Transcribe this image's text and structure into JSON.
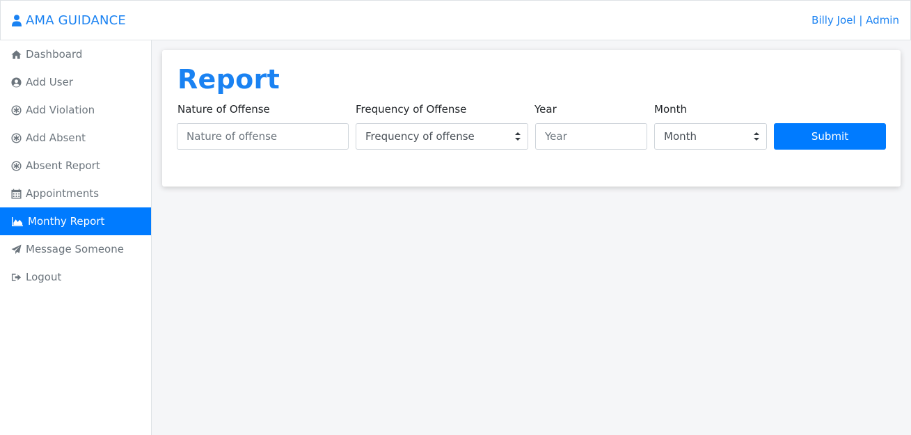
{
  "header": {
    "brand": "AMA GUIDANCE",
    "brand_icon": "user-icon",
    "user": "Billy Joel | Admin"
  },
  "sidebar": {
    "items": [
      {
        "label": "Dashboard",
        "icon": "home-icon",
        "active": false
      },
      {
        "label": "Add User",
        "icon": "user-circle-icon",
        "active": false
      },
      {
        "label": "Add Violation",
        "icon": "asterisk-circle-icon",
        "active": false
      },
      {
        "label": "Add Absent",
        "icon": "asterisk-circle-icon",
        "active": false
      },
      {
        "label": "Absent Report",
        "icon": "asterisk-circle-icon",
        "active": false
      },
      {
        "label": "Appointments",
        "icon": "calendar-icon",
        "active": false
      },
      {
        "label": "Monthy Report",
        "icon": "area-chart-icon",
        "active": true
      },
      {
        "label": "Message Someone",
        "icon": "paper-plane-icon",
        "active": false
      },
      {
        "label": "Logout",
        "icon": "sign-out-icon",
        "active": false
      }
    ]
  },
  "report": {
    "title": "Report",
    "nature": {
      "label": "Nature of Offense",
      "placeholder": "Nature of offense"
    },
    "frequency": {
      "label": "Frequency of Offense",
      "selected": "Frequency of offense"
    },
    "year": {
      "label": "Year",
      "placeholder": "Year"
    },
    "month": {
      "label": "Month",
      "selected": "Month"
    },
    "submit": "Submit"
  },
  "colors": {
    "accent": "#007bff",
    "brand_text": "#1a82f2",
    "sidebar_text": "#6c757d",
    "background": "#f5f6f8"
  }
}
